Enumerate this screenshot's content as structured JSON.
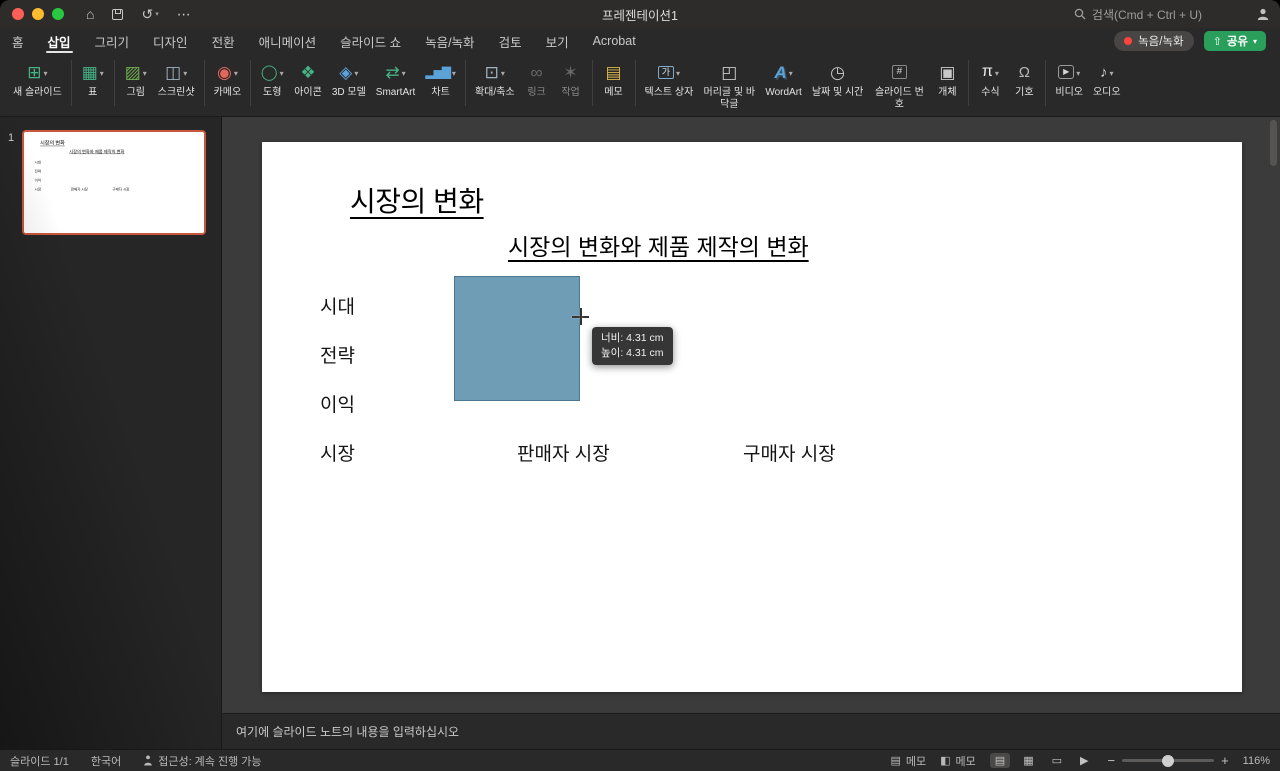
{
  "colors": {
    "share_green": "#2a9e5b",
    "record_red": "#ff453a",
    "selection_border": "#c8573d",
    "shape_fill": "#6f9db6",
    "shape_border": "#4a7893"
  },
  "titlebar": {
    "title": "프레젠테이션1",
    "search_placeholder": "검색(Cmd + Ctrl + U)"
  },
  "tabs": [
    {
      "name": "home",
      "label": "홈"
    },
    {
      "name": "insert",
      "label": "삽입",
      "active": true
    },
    {
      "name": "draw",
      "label": "그리기"
    },
    {
      "name": "design",
      "label": "디자인"
    },
    {
      "name": "transitions",
      "label": "전환"
    },
    {
      "name": "animations",
      "label": "애니메이션"
    },
    {
      "name": "slide-show",
      "label": "슬라이드 쇼"
    },
    {
      "name": "record",
      "label": "녹음/녹화"
    },
    {
      "name": "review",
      "label": "검토"
    },
    {
      "name": "view",
      "label": "보기"
    },
    {
      "name": "acrobat",
      "label": "Acrobat"
    }
  ],
  "quick_actions": {
    "record_label": "녹음/녹화",
    "share_label": "공유"
  },
  "ribbon": {
    "groups": [
      {
        "items": [
          {
            "name": "new-slide",
            "label": "새 슬라이드",
            "icon": "new-slide-icon",
            "dropdown": true
          }
        ]
      },
      {
        "items": [
          {
            "name": "table",
            "label": "표",
            "icon": "table-icon",
            "dropdown": true
          }
        ]
      },
      {
        "items": [
          {
            "name": "pictures",
            "label": "그림",
            "icon": "picture-icon",
            "dropdown": true
          },
          {
            "name": "screenshot",
            "label": "스크린샷",
            "icon": "screenshot-icon",
            "dropdown": true
          }
        ]
      },
      {
        "items": [
          {
            "name": "cameo",
            "label": "카메오",
            "icon": "cameo-icon",
            "dropdown": true
          }
        ]
      },
      {
        "items": [
          {
            "name": "shapes",
            "label": "도형",
            "icon": "shapes-icon",
            "dropdown": true
          },
          {
            "name": "icons",
            "label": "아이콘",
            "icon": "icons-icon",
            "dropdown": false
          },
          {
            "name": "3d-models",
            "label": "3D 모델",
            "icon": "3d-model-icon",
            "dropdown": true
          },
          {
            "name": "smartart",
            "label": "SmartArt",
            "icon": "smartart-icon",
            "dropdown": true
          },
          {
            "name": "chart",
            "label": "차트",
            "icon": "chart-icon",
            "dropdown": true
          }
        ]
      },
      {
        "items": [
          {
            "name": "zoom",
            "label": "확대/축소",
            "icon": "zoom-icon",
            "dropdown": true
          },
          {
            "name": "link",
            "label": "링크",
            "icon": "link-icon",
            "dropdown": false,
            "dim": true
          },
          {
            "name": "action",
            "label": "작업",
            "icon": "action-icon",
            "dropdown": false,
            "dim": true
          }
        ]
      },
      {
        "items": [
          {
            "name": "comment",
            "label": "메모",
            "icon": "comment-icon",
            "dropdown": false
          }
        ]
      },
      {
        "items": [
          {
            "name": "text-box",
            "label": "텍스트 상자",
            "icon": "text-box-icon",
            "dropdown": true
          },
          {
            "name": "header-footer",
            "label": "머리글 및 바닥글",
            "icon": "header-footer-icon",
            "dropdown": false
          },
          {
            "name": "wordart",
            "label": "WordArt",
            "icon": "wordart-icon",
            "dropdown": true
          },
          {
            "name": "date-time",
            "label": "날짜 및 시간",
            "icon": "date-time-icon",
            "dropdown": false
          },
          {
            "name": "slide-number",
            "label": "슬라이드 번호",
            "icon": "slide-number-icon",
            "dropdown": false
          },
          {
            "name": "object",
            "label": "개체",
            "icon": "object-icon",
            "dropdown": false
          }
        ]
      },
      {
        "items": [
          {
            "name": "equation",
            "label": "수식",
            "icon": "equation-icon",
            "dropdown": true
          },
          {
            "name": "symbol",
            "label": "기호",
            "icon": "symbol-icon",
            "dropdown": false
          }
        ]
      },
      {
        "items": [
          {
            "name": "video",
            "label": "비디오",
            "icon": "video-icon",
            "dropdown": true
          },
          {
            "name": "audio",
            "label": "오디오",
            "icon": "audio-icon",
            "dropdown": true
          }
        ]
      }
    ]
  },
  "thumbnail_panel": {
    "slide_index": "1"
  },
  "slide": {
    "title": "시장의 변화",
    "subtitle": "시장의 변화와 제품 제작의 변화",
    "row_labels": [
      "시대",
      "전략",
      "이익",
      "시장"
    ],
    "market_labels": [
      "판매자 시장",
      "구매자 시장"
    ],
    "size_tooltip": {
      "width": "너비: 4.31 cm",
      "height": "높이: 4.31 cm"
    }
  },
  "notes": {
    "placeholder": "여기에 슬라이드 노트의 내용을 입력하십시오"
  },
  "statusbar": {
    "slide_count": "슬라이드 1/1",
    "language": "한국어",
    "accessibility": "접근성: 계속 진행 가능",
    "notes_label": "메모",
    "comments_label": "메모",
    "zoom_level": "116%"
  }
}
